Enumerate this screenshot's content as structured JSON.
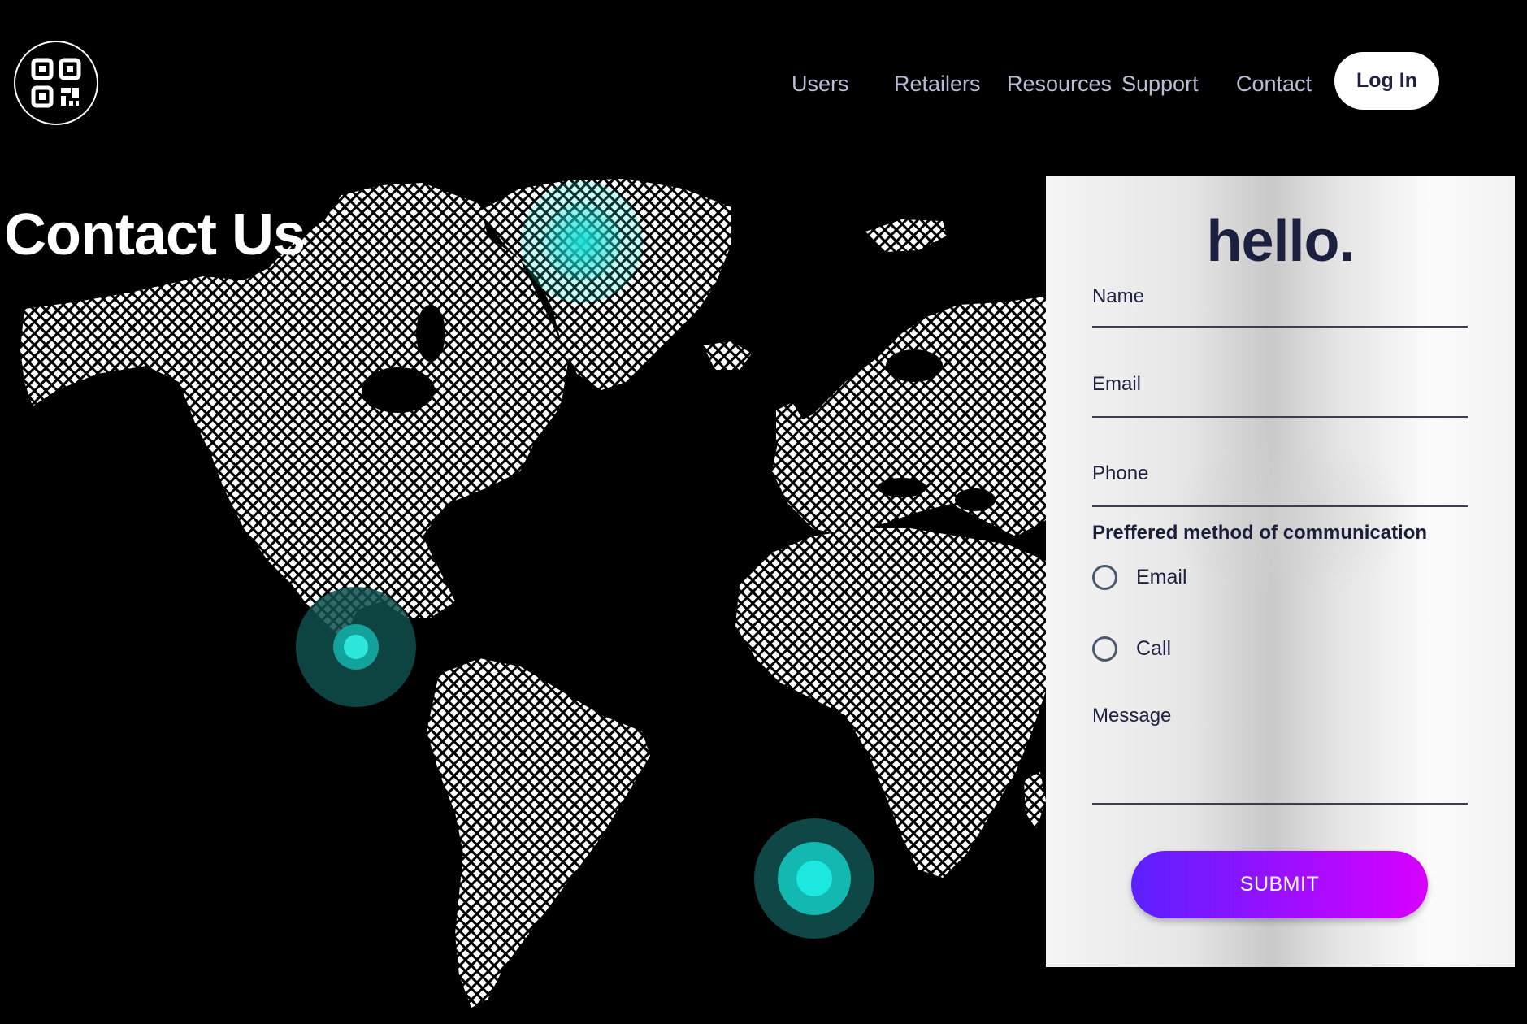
{
  "nav": {
    "items": [
      {
        "label": "Users"
      },
      {
        "label": "Retailers"
      },
      {
        "label": "Resources"
      },
      {
        "label": "Support"
      },
      {
        "label": "Contact"
      }
    ],
    "login_label": "Log In"
  },
  "page": {
    "title": "Contact Us"
  },
  "form": {
    "greeting": "hello.",
    "name_label": "Name",
    "email_label": "Email",
    "phone_label": "Phone",
    "preference_label": "Preffered method of communication",
    "options": [
      {
        "label": "Email",
        "selected": false
      },
      {
        "label": "Call",
        "selected": false
      }
    ],
    "message_label": "Message",
    "submit_label": "SUBMIT"
  },
  "colors": {
    "background": "#000000",
    "marker": "#19e0d8",
    "title_dark": "#1c2040",
    "nav_text": "#b8bdd6",
    "submit_start": "#5b21ff",
    "submit_end": "#d800ff"
  },
  "icons": {
    "logo": "qr-code-icon"
  }
}
